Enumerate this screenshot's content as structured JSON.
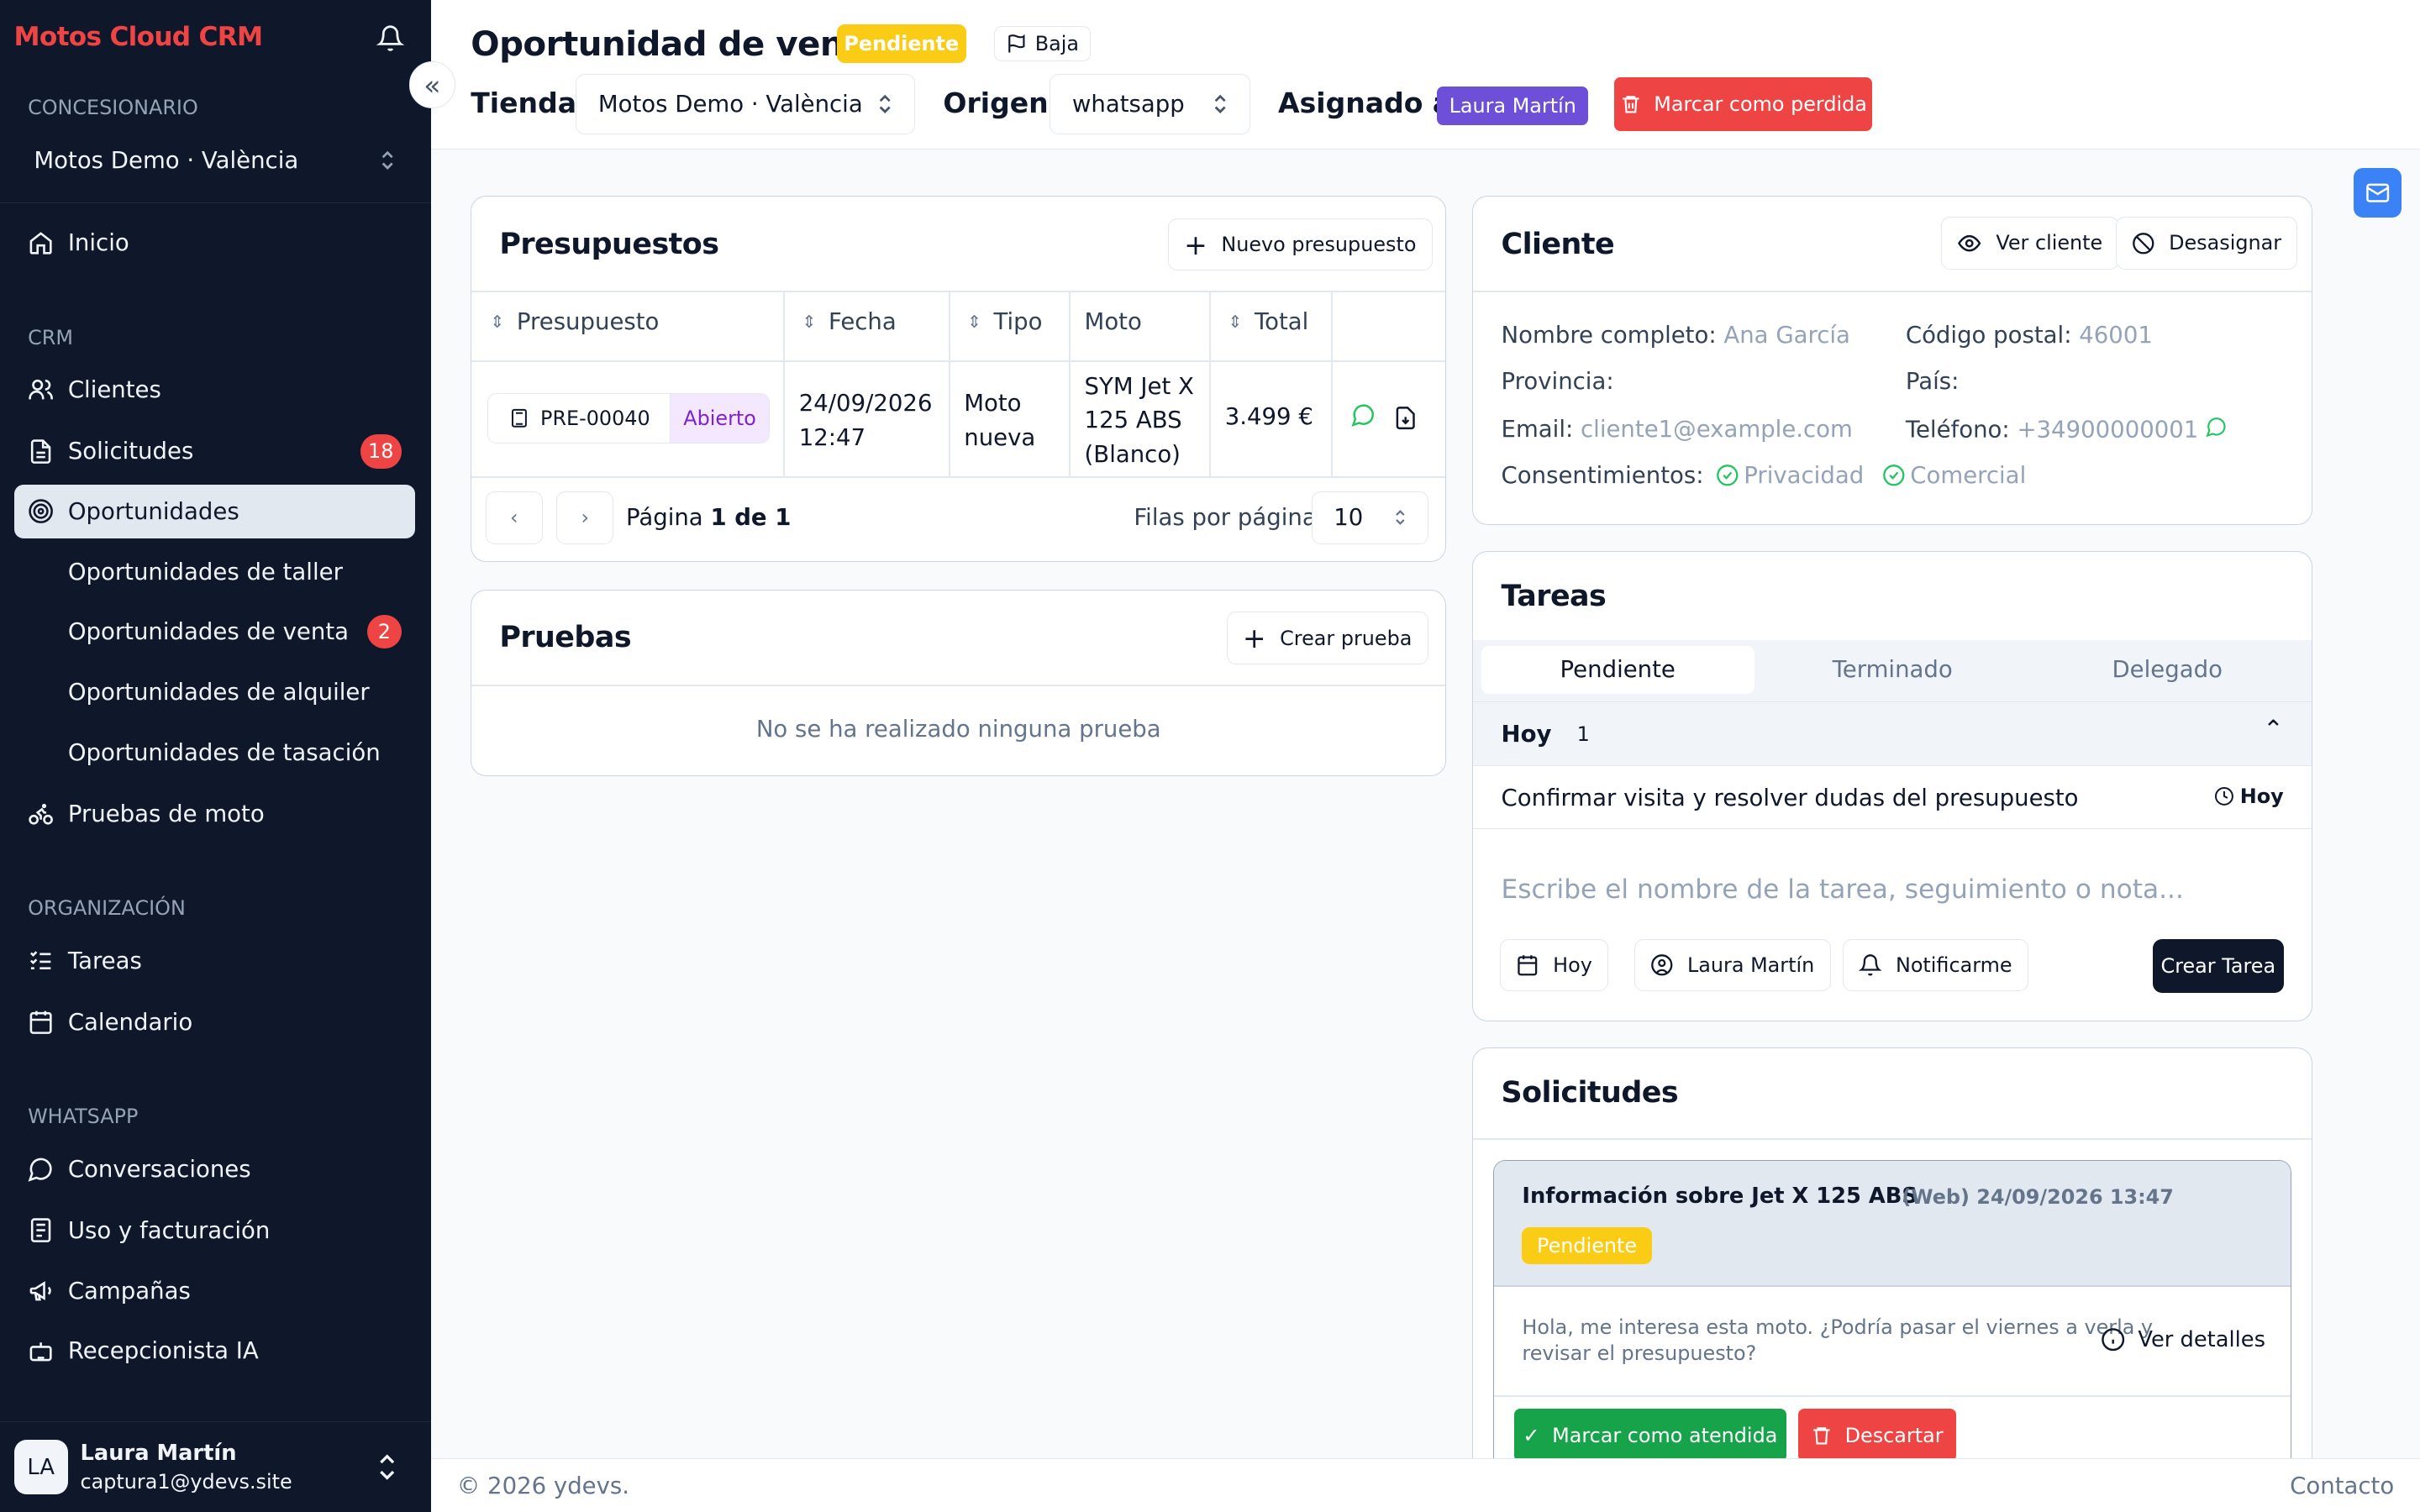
{
  "app": {
    "title": "Motos Cloud CRM"
  },
  "sidebar": {
    "dealer_label": "CONCESIONARIO",
    "dealer": "Motos Demo · València",
    "home": "Inicio",
    "crm_label": "CRM",
    "items": [
      {
        "label": "Clientes"
      },
      {
        "label": "Solicitudes",
        "badge": "18"
      },
      {
        "label": "Oportunidades"
      },
      {
        "label": "Oportunidades de taller"
      },
      {
        "label": "Oportunidades de venta",
        "badge": "2"
      },
      {
        "label": "Oportunidades de alquiler"
      },
      {
        "label": "Oportunidades de tasación"
      },
      {
        "label": "Pruebas de moto"
      }
    ],
    "org_label": "ORGANIZACIÓN",
    "org_items": [
      {
        "label": "Tareas"
      },
      {
        "label": "Calendario"
      }
    ],
    "wa_label": "WHATSAPP",
    "wa_items": [
      {
        "label": "Conversaciones"
      },
      {
        "label": "Uso y facturación"
      },
      {
        "label": "Campañas"
      },
      {
        "label": "Recepcionista IA"
      }
    ],
    "user": {
      "initials": "LA",
      "name": "Laura Martín",
      "email": "captura1@ydevs.site"
    }
  },
  "header": {
    "title": "Oportunidad de venta",
    "status": "Pendiente",
    "priority": "Baja",
    "store_label": "Tienda:",
    "store": "Motos Demo · València",
    "origin_label": "Origen:",
    "origin": "whatsapp",
    "assigned_label": "Asignado a:",
    "assigned": "Laura Martín",
    "lost_button": "Marcar como perdida"
  },
  "quotes": {
    "title": "Presupuestos",
    "new_button": "Nuevo presupuesto",
    "columns": [
      "Presupuesto",
      "Fecha",
      "Tipo",
      "Moto",
      "Total"
    ],
    "rows": [
      {
        "id": "PRE-00040",
        "status": "Abierto",
        "date": "24/09/2026",
        "time": "12:47",
        "type1": "Moto",
        "type2": "nueva",
        "moto1": "SYM Jet X",
        "moto2": "125 ABS",
        "moto3": "(Blanco)",
        "total": "3.499 €"
      }
    ],
    "page_prefix": "Página",
    "page_value": "1 de 1",
    "rows_label": "Filas por página",
    "rows_value": "10"
  },
  "tests": {
    "title": "Pruebas",
    "new_button": "Crear prueba",
    "empty": "No se ha realizado ninguna prueba"
  },
  "client": {
    "title": "Cliente",
    "view_button": "Ver cliente",
    "unassign_button": "Desasignar",
    "name_label": "Nombre completo:",
    "name": "Ana García",
    "zip_label": "Código postal:",
    "zip": "46001",
    "province_label": "Provincia:",
    "country_label": "País:",
    "email_label": "Email:",
    "email": "cliente1@example.com",
    "phone_label": "Teléfono:",
    "phone": "+34900000001",
    "consent_label": "Consentimientos:",
    "consent1": "Privacidad",
    "consent2": "Comercial"
  },
  "tasks": {
    "title": "Tareas",
    "tabs": [
      "Pendiente",
      "Terminado",
      "Delegado"
    ],
    "group": "Hoy",
    "count": "1",
    "task": "Confirmar visita y resolver dudas del presupuesto",
    "task_due": "Hoy",
    "placeholder": "Escribe el nombre de la tarea, seguimiento o nota...",
    "date_button": "Hoy",
    "user_button": "Laura Martín",
    "notify_button": "Notificarme",
    "create_button": "Crear Tarea"
  },
  "requests": {
    "title": "Solicitudes",
    "item_title": "Información sobre Jet X 125 ABS",
    "item_meta": "(Web) 24/09/2026 13:47",
    "item_status": "Pendiente",
    "message_line1": "Hola, me interesa esta moto. ¿Podría pasar el viernes a verla y",
    "message_line2": "revisar el presupuesto?",
    "details": "Ver detalles",
    "attend_button": "Marcar como atendida",
    "discard_button": "Descartar"
  },
  "footer": {
    "copyright": "© 2026 ydevs.",
    "contact": "Contacto"
  },
  "colors": {
    "brand": "#ef4444",
    "sidebar": "#0f172a",
    "pending": "#facc15",
    "assigned": "#6d4fd8",
    "attend": "#16a34a"
  }
}
